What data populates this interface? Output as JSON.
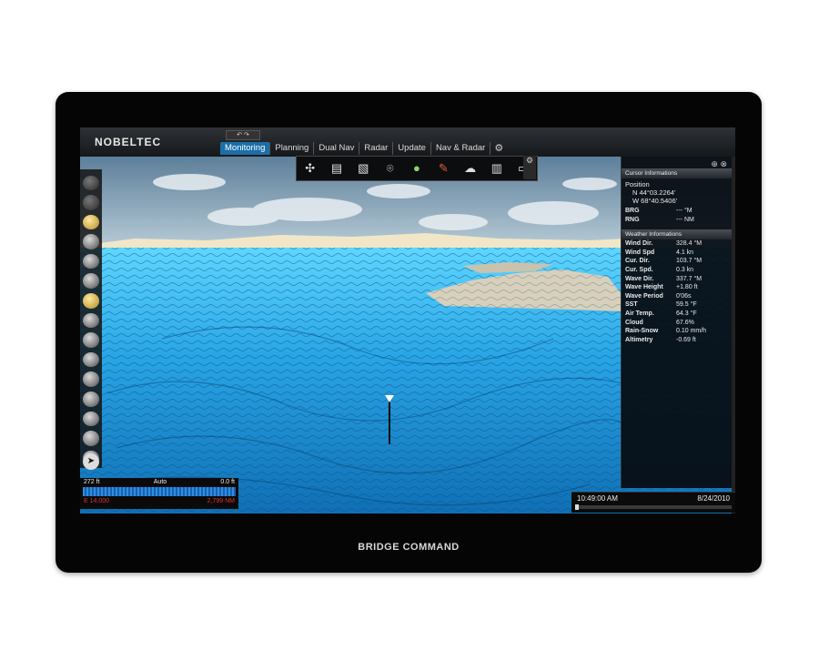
{
  "app": {
    "logo": "NOBELTEC",
    "undo_label": "↶ ↷"
  },
  "tabs": [
    {
      "label": "Monitoring",
      "active": true
    },
    {
      "label": "Planning",
      "active": false
    },
    {
      "label": "Dual Nav",
      "active": false
    },
    {
      "label": "Radar",
      "active": false
    },
    {
      "label": "Update",
      "active": false
    },
    {
      "label": "Nav & Radar",
      "active": false
    }
  ],
  "toolbar_icons": [
    "compass-rose-icon",
    "layers-icon",
    "chart-icon",
    "vessel-icon",
    "waypoint-icon",
    "route-icon",
    "weather-icon",
    "book-icon",
    "message-icon"
  ],
  "cursor_panel": {
    "title": "Cursor Informations",
    "position_label": "Position",
    "lat": "N 44°03.2264'",
    "lon": "W 68°40.5406'",
    "brg_label": "BRG",
    "brg_value": "--- °M",
    "rng_label": "RNG",
    "rng_value": "--- NM"
  },
  "weather_panel": {
    "title": "Weather Informations",
    "rows": [
      {
        "k": "Wind Dir.",
        "v": "328.4 °M"
      },
      {
        "k": "Wind Spd",
        "v": "4.1 kn"
      },
      {
        "k": "Cur. Dir.",
        "v": "103.7 °M"
      },
      {
        "k": "Cur. Spd.",
        "v": "0.3 kn"
      },
      {
        "k": "Wave Dir.",
        "v": "337.7 °M"
      },
      {
        "k": "Wave Height",
        "v": "+1.80 ft"
      },
      {
        "k": "Wave Period",
        "v": "0'06s"
      },
      {
        "k": "SST",
        "v": "59.5 °F"
      },
      {
        "k": "Air Temp.",
        "v": "64.3 °F"
      },
      {
        "k": "Cloud",
        "v": "67.6%"
      },
      {
        "k": "Rain-Snow",
        "v": "0.10 mm/h"
      },
      {
        "k": "Altimetry",
        "v": "-0.69 ft"
      }
    ]
  },
  "depth": {
    "left": "272 ft",
    "mode": "Auto",
    "right": "0.0 ft",
    "bottom_left": "E 14,000",
    "bottom_right": "2,799 NM"
  },
  "timebar": {
    "time": "10:49:00 AM",
    "date": "8/24/2010"
  },
  "device_brand": "BRIDGE COMMAND",
  "colors": {
    "accent": "#1b6fa8",
    "water": "#2aa9e8"
  }
}
